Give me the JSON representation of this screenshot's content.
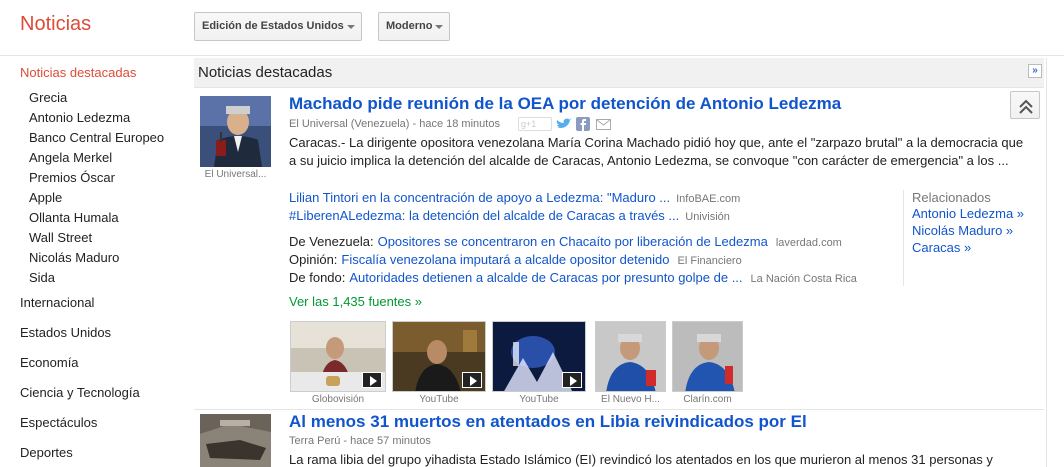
{
  "header": {
    "logo": "Noticias",
    "edition_label": "Edición de Estados Unidos",
    "mode_label": "Moderno"
  },
  "sidebar": {
    "top": "Noticias destacadas",
    "subitems": [
      "Grecia",
      "Antonio Ledezma",
      "Banco Central Europeo",
      "Angela Merkel",
      "Premios Óscar",
      "Apple",
      "Ollanta Humala",
      "Wall Street",
      "Nicolás Maduro",
      "Sida"
    ],
    "sections": [
      "Internacional",
      "Estados Unidos",
      "Economía",
      "Ciencia y Tecnología",
      "Espectáculos",
      "Deportes"
    ]
  },
  "section_bar": {
    "title": "Noticias destacadas",
    "expand_glyph": "»"
  },
  "story1": {
    "thumb_caption": "El Universal...",
    "headline": "Machado pide reunión de la OEA por detención de Antonio Ledezma",
    "source": "El Universal (Venezuela) - hace 18 minutos",
    "snippet": "Caracas.- La dirigente opositora venezolana María Corina Machado pidió hoy que, ante el \"zarpazo brutal\" a la democracia que a su juicio implica la detención del alcalde de Caracas, Antonio Ledezma, se convoque \"con carácter de emergencia\" a los ...",
    "related_links": [
      {
        "text": "Lilian Tintori en la concentración de apoyo a Ledezma: \"Maduro ...",
        "source": "InfoBAE.com"
      },
      {
        "text": "#LiberenALedezma: la detención del alcalde de Caracas a través ...",
        "source": "Univisión"
      }
    ],
    "labeled_links": [
      {
        "label": "De Venezuela:",
        "text": "Opositores se concentraron en Chacaíto por liberación de Ledezma",
        "source": "laverdad.com"
      },
      {
        "label": "Opinión:",
        "text": "Fiscalía venezolana imputará a alcalde opositor detenido",
        "source": "El Financiero"
      },
      {
        "label": "De fondo:",
        "text": "Autoridades detienen a alcalde de Caracas por presunto golpe de ...",
        "source": "La Nación Costa Rica"
      }
    ],
    "sources_link": "Ver las 1,435 fuentes »",
    "related_box": {
      "title": "Relacionados",
      "links": [
        "Antonio Ledezma »",
        "Nicolás Maduro »",
        "Caracas »"
      ]
    },
    "media_captions": [
      "Globovisión",
      "YouTube",
      "YouTube",
      "El Nuevo H...",
      "Clarín.com"
    ],
    "share_gplus": "g+1"
  },
  "story2": {
    "headline": "Al menos 31 muertos en atentados en Libia reivindicados por El",
    "source": "Terra Perú - hace 57 minutos",
    "snippet": "La rama libia del grupo yihadista Estado Islámico (EI) revindicó los atentados en los que murieron al menos 31 personas y"
  },
  "colors": {
    "accent_red": "#dd4b39",
    "link_blue": "#1155cc",
    "source_green": "#009933"
  }
}
